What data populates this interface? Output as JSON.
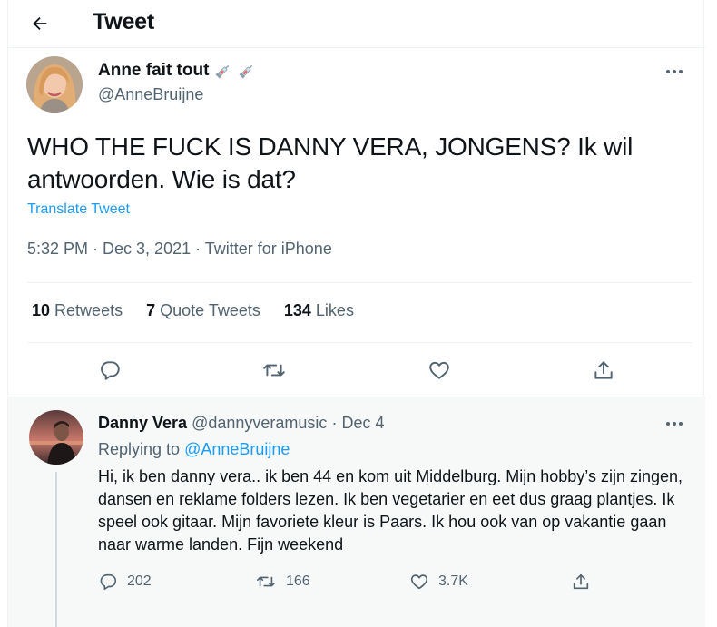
{
  "header": {
    "title": "Tweet",
    "back_icon": "arrow-left-icon"
  },
  "tweet": {
    "author_name": "Anne fait tout",
    "author_badges": [
      "syringe-icon",
      "syringe-icon"
    ],
    "author_handle": "@AnneBruijne",
    "text": "WHO THE FUCK IS DANNY VERA, JONGENS? Ik wil antwoorden. Wie is dat?",
    "translate_label": "Translate Tweet",
    "meta": "5:32 PM · Dec 3, 2021 · Twitter for iPhone",
    "stats": {
      "retweets_count": "10",
      "retweets_label": "Retweets",
      "quotes_count": "7",
      "quotes_label": "Quote Tweets",
      "likes_count": "134",
      "likes_label": "Likes"
    },
    "actions": [
      "reply-icon",
      "retweet-icon",
      "like-icon",
      "share-icon"
    ]
  },
  "reply": {
    "author_name": "Danny Vera",
    "author_handle": "@dannyveramusic",
    "separator": "·",
    "date": "Dec 4",
    "replying_prefix": "Replying to",
    "replying_to": "@AnneBruijne",
    "text": "Hi, ik ben danny vera.. ik ben 44 en kom uit Middelburg. Mijn hobby’s zijn zingen, dansen en reklame folders lezen. Ik ben vegetarier en eet dus graag plantjes. Ik speel ook gitaar. Mijn favoriete kleur is Paars. Ik hou ook van op vakantie gaan naar warme landen. Fijn weekend",
    "actions": {
      "reply_count": "202",
      "retweet_count": "166",
      "like_count": "3.7K"
    }
  },
  "colors": {
    "accent": "#1d9bf0",
    "secondary_text": "#536471",
    "primary_text": "#0f1419",
    "divider": "#eff3f4"
  }
}
